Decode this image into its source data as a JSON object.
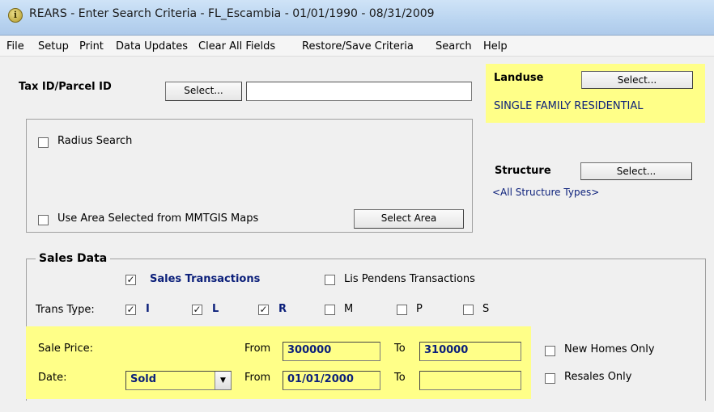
{
  "window": {
    "title": "REARS - Enter Search Criteria - FL_Escambia - 01/01/1990 - 08/31/2009",
    "icon": "info-icon"
  },
  "menu": [
    "File",
    "Setup",
    "Print",
    "Data Updates",
    "Clear All Fields",
    "Restore/Save Criteria",
    "Search",
    "Help"
  ],
  "tax_id": {
    "label": "Tax ID/Parcel ID",
    "select_label": "Select...",
    "value": ""
  },
  "landuse": {
    "label": "Landuse",
    "select_label": "Select...",
    "value": "SINGLE FAMILY RESIDENTIAL"
  },
  "structure": {
    "label": "Structure",
    "select_label": "Select...",
    "value": "<All Structure Types>"
  },
  "area": {
    "radius_label": "Radius Search",
    "radius_checked": false,
    "use_area_label": "Use Area Selected from MMTGIS Maps",
    "use_area_checked": false,
    "select_area_label": "Select Area"
  },
  "sales": {
    "group_title": "Sales Data",
    "sales_tx_label": "Sales Transactions",
    "sales_tx_checked": true,
    "lis_label": "Lis Pendens Transactions",
    "lis_checked": false,
    "trans_type_label": "Trans Type:",
    "trans_types": [
      {
        "code": "I",
        "checked": true
      },
      {
        "code": "L",
        "checked": true
      },
      {
        "code": "R",
        "checked": true
      },
      {
        "code": "M",
        "checked": false
      },
      {
        "code": "P",
        "checked": false
      },
      {
        "code": "S",
        "checked": false
      }
    ],
    "sale_price_label": "Sale Price:",
    "from_label": "From",
    "to_label": "To",
    "price_from": "300000",
    "price_to": "310000",
    "date_label": "Date:",
    "date_type": "Sold",
    "date_from": "01/01/2000",
    "date_to": "",
    "new_homes_label": "New Homes Only",
    "new_homes_checked": false,
    "resales_label": "Resales Only",
    "resales_checked": false
  },
  "colors": {
    "highlight": "#ffff88",
    "navy_text": "#0b1f7a"
  }
}
